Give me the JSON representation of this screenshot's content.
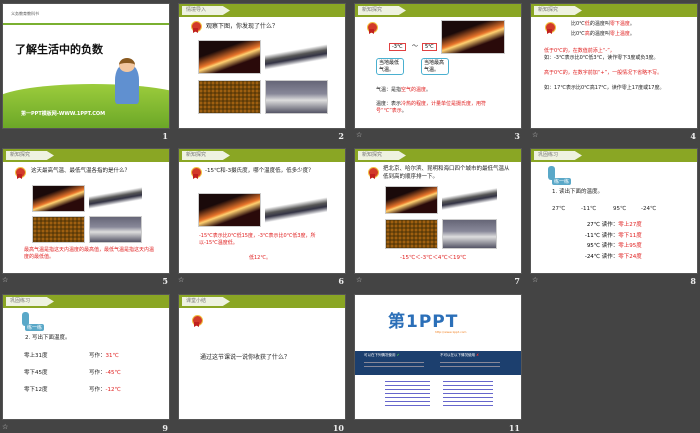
{
  "slides": [
    {
      "num": "1",
      "top_label": "义务教育教科书",
      "title": "了解生活中的负数",
      "footer": "第一PPT模板网-WWW.1PPT.COM"
    },
    {
      "num": "2",
      "section": "情境导入",
      "question": "观察下图，你发现了什么？"
    },
    {
      "num": "3",
      "section": "新知探究",
      "low": "-3℃",
      "tilde": "～",
      "high": "5℃",
      "low_note": "当地最低气温。",
      "high_note": "当地最高气温。",
      "line1_a": "气温：是指",
      "line1_b": "空气的温度",
      "line1_c": "。",
      "line2_a": "温度：表示",
      "line2_b": "冷热的程度，计量单位是摄氏度，用符号“℃”表示",
      "line2_c": "。"
    },
    {
      "num": "4",
      "section": "新知探究",
      "l1a": "比0℃",
      "l1b": "低",
      "l1c": "的温度叫",
      "l1d": "零下温度",
      "l1e": "。",
      "l2a": "比0℃",
      "l2b": "高",
      "l2c": "的温度叫",
      "l2d": "零上温度",
      "l2e": "。",
      "p1": "低于0℃的，在数值前添上“-”，",
      "p2": "如：-3℃表示比0℃低3℃，读作零下3度或负3度。",
      "p3": "高于0℃的，在数字前加“+”，一般情况下省略不写。",
      "p4": "如：17℃表示比0℃高17℃，读作零上17度或17度。"
    },
    {
      "num": "5",
      "section": "新知探究",
      "question": "这天最高气温、最低气温各指的是什么？",
      "answer": "最高气温是指这天内温度的最高值，最低气温是指这天内温度的最低值。"
    },
    {
      "num": "6",
      "section": "新知探究",
      "question": "-15℃和-3摄氏度，哪个温度低，低多少度？",
      "answer": "-15℃表示比0℃低15度，-3℃表示比0℃低3度，所以-15℃温度低。",
      "answer2": "低12℃。"
    },
    {
      "num": "7",
      "section": "新知探究",
      "question": "把北京、哈尔滨、昆明和海口四个城市的最低气温从低到高的顺序排一下。",
      "answer": "-15℃＜-3℃＜4℃＜19℃"
    },
    {
      "num": "8",
      "section": "巩固练习",
      "badge": "练一练",
      "task": "1. 读出下面的温度。",
      "temps": [
        "27℃",
        "-11℃",
        "95℃",
        "-24℃"
      ],
      "rows": [
        {
          "t": "27℃",
          "k": "读作：",
          "v": "零上27度"
        },
        {
          "t": "-11℃",
          "k": "读作：",
          "v": "零下11度"
        },
        {
          "t": "95℃",
          "k": "读作：",
          "v": "零上95度"
        },
        {
          "t": "-24℃",
          "k": "读作：",
          "v": "零下24度"
        }
      ]
    },
    {
      "num": "9",
      "section": "巩固练习",
      "badge": "练一练",
      "task": "2. 写出下面温度。",
      "rows": [
        {
          "t": "零上31度",
          "k": "写作：",
          "v": "31℃"
        },
        {
          "t": "零下45度",
          "k": "写作：",
          "v": "-45℃"
        },
        {
          "t": "零下12度",
          "k": "写作：",
          "v": "-12℃"
        }
      ]
    },
    {
      "num": "10",
      "section": "课堂小结",
      "question": "通过这节课说一说你收获了什么？"
    },
    {
      "num": "11",
      "logo": "第1PPT",
      "url": "http://www.1ppt.com",
      "ok": "可以在下列情况使用",
      "no": "不可以在以下情况使用"
    }
  ],
  "colors": {
    "header_green": "#8aa624",
    "red": "#e02020",
    "navy": "#1c3f6e"
  }
}
